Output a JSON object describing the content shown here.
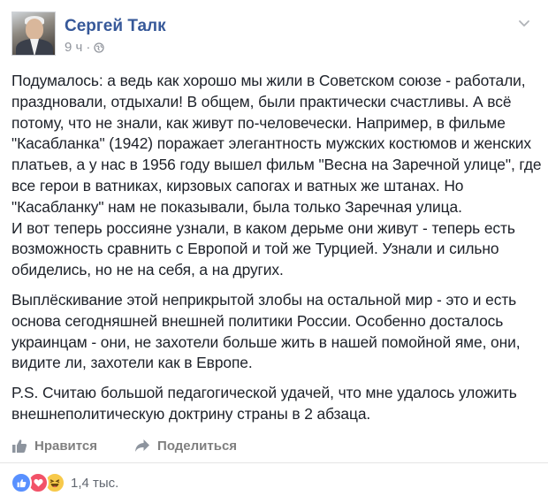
{
  "post": {
    "author": "Сергей Талк",
    "time": "9 ч",
    "separator": "·",
    "paragraphs": [
      "Подумалось: а ведь как хорошо мы жили в Советском союзе - работали, праздновали, отдыхали! В общем, были практически счастливы. А всё потому, что не знали, как живут по-человечески. Например, в фильме \"Касабланка\" (1942) поражает элегантность мужских костюмов и женских платьев, а у нас в 1956 году вышел фильм \"Весна на Заречной улице\", где все герои в ватниках, кирзовых сапогах и ватных же штанах. Но \"Касабланку\" нам не показывали, была только Заречная улица.",
      "И вот теперь россияне узнали, в каком дерьме они живут - теперь есть возможность сравнить с Европой и той же Турцией. Узнали и сильно обиделись, но не на себя, а на других.",
      "Выплёскивание этой неприкрытой злобы на остальной мир - это и есть основа сегодняшней внешней политики России. Особенно досталось украинцам - они, не захотели больше жить в нашей помойной яме, они, видите ли, захотели как в Европе.",
      "P.S. Считаю большой педагогической удачей, что мне удалось уложить внешнеполитическую доктрину страны в 2 абзаца."
    ]
  },
  "actions": {
    "like_label": "Нравится",
    "share_label": "Поделиться"
  },
  "reactions": {
    "count": "1,4 тыс.",
    "types": [
      "like",
      "love",
      "haha"
    ]
  },
  "icons": {
    "audience": "globe-icon",
    "options": "chevron-down-icon",
    "like": "thumbs-up-icon",
    "share": "share-arrow-icon"
  },
  "colors": {
    "author_link": "#365899",
    "body_text": "#1d2129",
    "muted": "#90949c",
    "like_reaction": "#5890ff",
    "love_reaction": "#f25268",
    "haha_reaction": "#f7c94a"
  }
}
